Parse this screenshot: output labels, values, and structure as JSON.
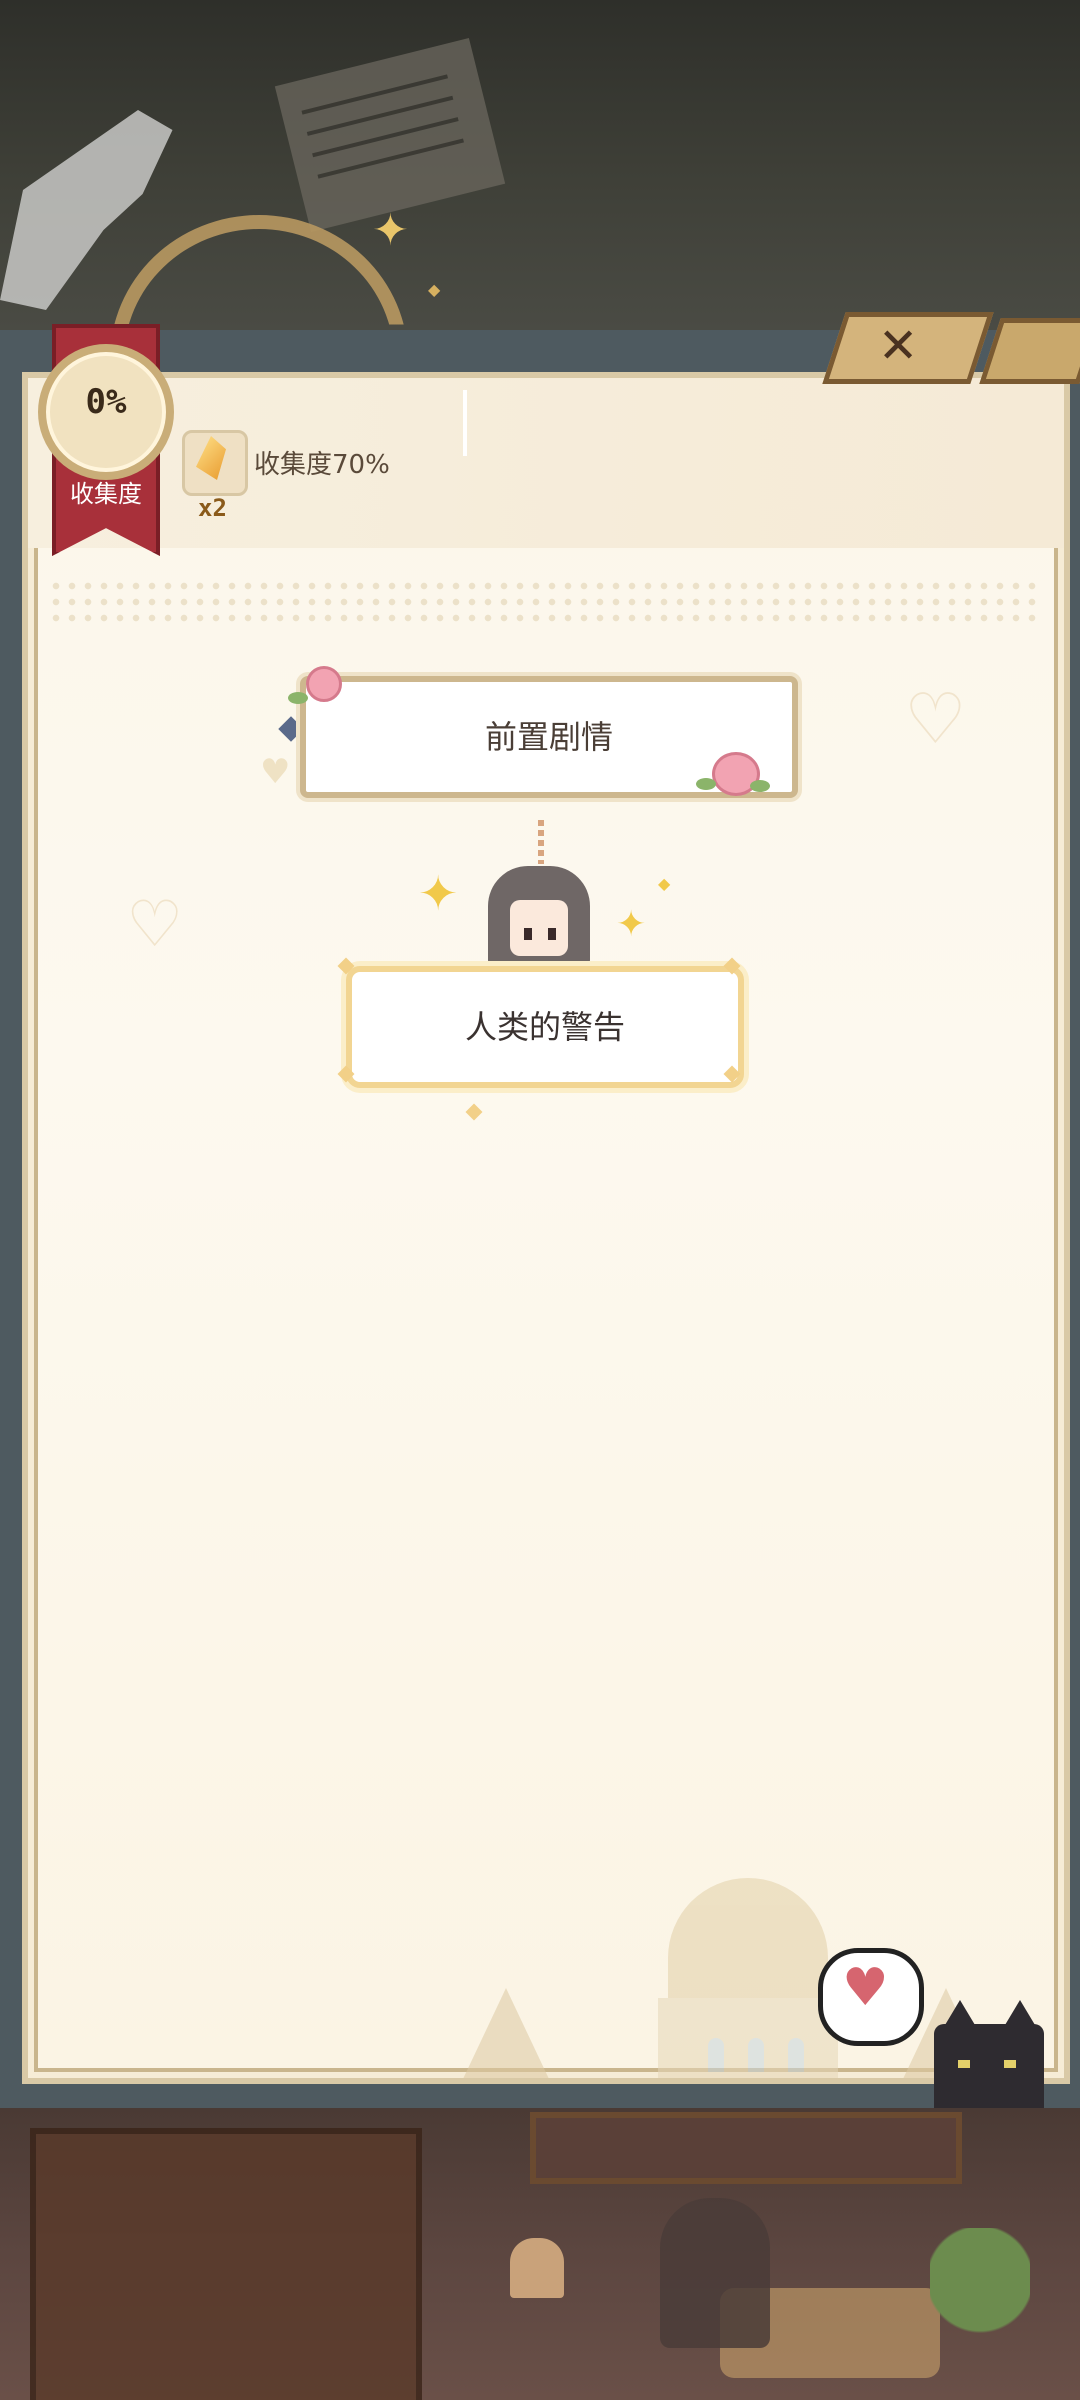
{
  "collection": {
    "percent": "0%",
    "label": "收集度"
  },
  "reward": {
    "count": "x2",
    "label": "收集度70%"
  },
  "story_nodes": [
    {
      "title": "前置剧情"
    },
    {
      "title": "人类的警告"
    }
  ],
  "close": {
    "glyph": "✕"
  },
  "colors": {
    "ribbon": "#a8303a",
    "gold": "#c9ad78",
    "panel_bg": "#fbf6ea",
    "frame": "#4e5a60",
    "heart": "#d6656f"
  }
}
